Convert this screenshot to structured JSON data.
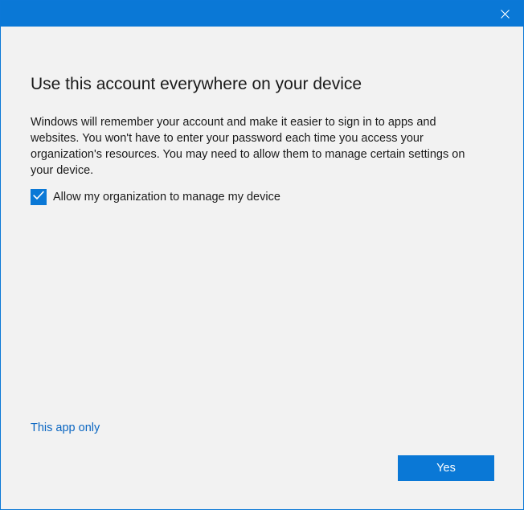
{
  "titlebar": {
    "close_icon": "close-icon",
    "accent_color": "#0a78d6"
  },
  "dialog": {
    "heading": "Use this account everywhere on your device",
    "body": "Windows will remember your account and make it easier to sign in to apps and websites. You won't have to enter your password each time you access your organization's resources. You may need to allow them to manage certain settings on your device.",
    "checkbox": {
      "label": "Allow my organization to manage my device",
      "checked": true,
      "icon": "checkmark-icon"
    },
    "link_label": "This app only",
    "primary_button_label": "Yes"
  },
  "colors": {
    "accent": "#0a78d6",
    "link": "#0a66c2",
    "background": "#f2f2f2",
    "text": "#1a1a1a"
  }
}
